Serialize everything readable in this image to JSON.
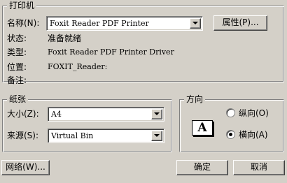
{
  "printer": {
    "group_title": "打印机",
    "name_label": "名称(N):",
    "name_value": "Foxit Reader PDF Printer",
    "properties_button": "属性(P)...",
    "status_label": "状态:",
    "status_value": "准备就绪",
    "type_label": "类型:",
    "type_value": "Foxit Reader PDF Printer Driver",
    "where_label": "位置:",
    "where_value": "FOXIT_Reader:",
    "comment_label": "备注:",
    "comment_value": ""
  },
  "paper": {
    "group_title": "纸张",
    "size_label": "大小(Z):",
    "size_value": "A4",
    "source_label": "来源(S):",
    "source_value": "Virtual Bin"
  },
  "orientation": {
    "group_title": "方向",
    "icon_letter": "A",
    "portrait_label": "纵向(O)",
    "landscape_label": "横向(A)",
    "selected": "landscape"
  },
  "footer": {
    "network_button": "网络(W)...",
    "ok_button": "确定",
    "cancel_button": "取消"
  }
}
